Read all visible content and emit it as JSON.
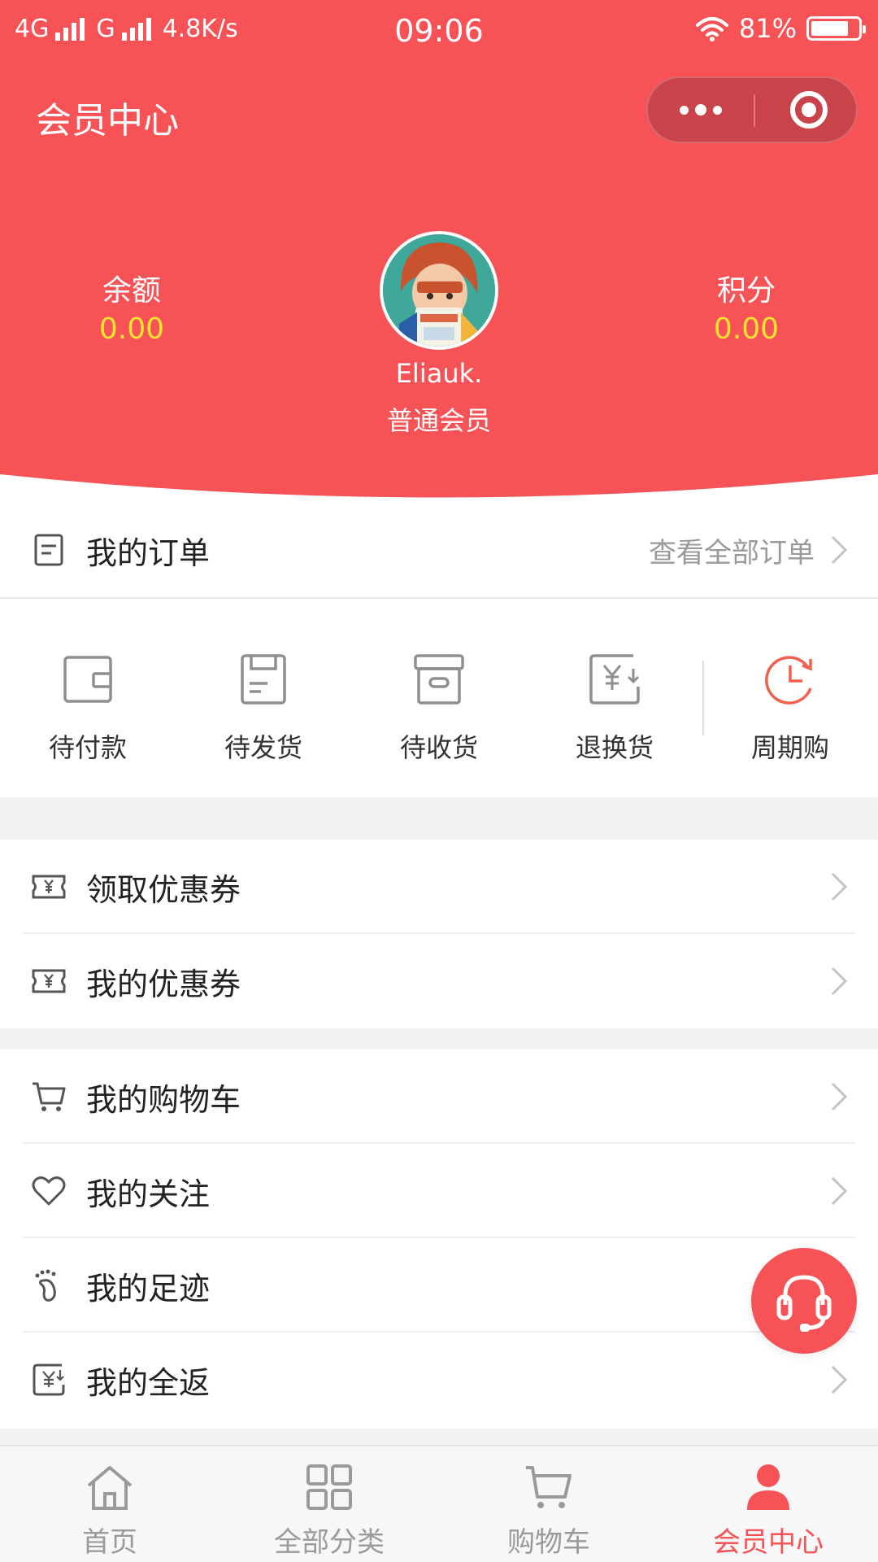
{
  "status_bar": {
    "network_1": "4G",
    "network_2": "G",
    "speed": "4.8K/s",
    "time": "09:06",
    "battery": "81%",
    "battery_level": 0.81
  },
  "nav": {
    "title": "会员中心"
  },
  "profile": {
    "balance_label": "余额",
    "balance_value": "0.00",
    "points_label": "积分",
    "points_value": "0.00",
    "username": "Eliauk.",
    "level": "普通会员"
  },
  "orders": {
    "title": "我的订单",
    "view_all": "查看全部订单",
    "items": [
      {
        "label": "待付款",
        "icon": "wallet-icon"
      },
      {
        "label": "待发货",
        "icon": "package-icon"
      },
      {
        "label": "待收货",
        "icon": "box-icon"
      },
      {
        "label": "退换货",
        "icon": "refund-icon"
      },
      {
        "label": "周期购",
        "icon": "clock-icon"
      }
    ]
  },
  "menu": {
    "get_coupons": "领取优惠券",
    "my_coupons": "我的优惠券",
    "cart": "我的购物车",
    "follows": "我的关注",
    "footprints": "我的足迹",
    "rebate": "我的全返"
  },
  "tabbar": {
    "items": [
      {
        "label": "首页",
        "icon": "home-icon"
      },
      {
        "label": "全部分类",
        "icon": "grid-icon"
      },
      {
        "label": "购物车",
        "icon": "cart-icon"
      },
      {
        "label": "会员中心",
        "icon": "user-icon"
      }
    ],
    "active_index": 3
  },
  "colors": {
    "accent": "#f75256",
    "value_yellow": "#f8e42e"
  }
}
